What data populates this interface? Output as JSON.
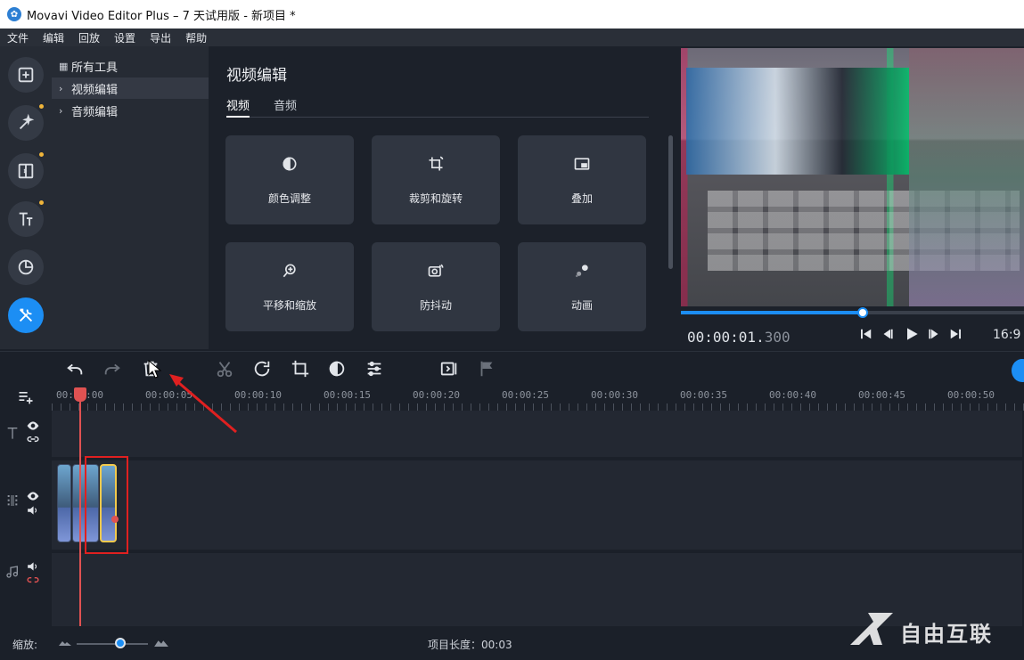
{
  "window": {
    "title": "Movavi Video Editor Plus – 7 天试用版 - 新项目 *"
  },
  "menu": [
    "文件",
    "编辑",
    "回放",
    "设置",
    "导出",
    "帮助"
  ],
  "rail": {
    "icons": [
      "import-icon",
      "magic-wand-icon",
      "transition-icon",
      "titles-icon",
      "sticker-icon",
      "tools-icon"
    ]
  },
  "tree": {
    "items": [
      {
        "label": "所有工具"
      },
      {
        "label": "视频编辑"
      },
      {
        "label": "音频编辑"
      }
    ],
    "selected_index": 1
  },
  "tools": {
    "title": "视频编辑",
    "tabs": [
      {
        "label": "视频"
      },
      {
        "label": "音频"
      }
    ],
    "active_tab": 0,
    "tiles": [
      {
        "label": "颜色调整",
        "icon": "contrast-icon"
      },
      {
        "label": "裁剪和旋转",
        "icon": "crop-rotate-icon"
      },
      {
        "label": "叠加",
        "icon": "overlay-icon"
      },
      {
        "label": "平移和缩放",
        "icon": "zoom-icon"
      },
      {
        "label": "防抖动",
        "icon": "stabilize-icon"
      },
      {
        "label": "动画",
        "icon": "animation-icon"
      }
    ]
  },
  "preview": {
    "timecode_main": "00:00:01.",
    "timecode_ms": "300",
    "aspect": "16:9",
    "progress_fraction": 0.53
  },
  "timeline": {
    "ruler": [
      "00:00:00",
      "00:00:05",
      "00:00:10",
      "00:00:15",
      "00:00:20",
      "00:00:25",
      "00:00:30",
      "00:00:35",
      "00:00:40",
      "00:00:45",
      "00:00:50"
    ]
  },
  "bottom": {
    "zoom_label": "缩放:",
    "project_length": "项目长度：00:03"
  },
  "watermark": {
    "text": "自由互联"
  },
  "colors": {
    "accent": "#1c8ef4",
    "playhead": "#e05252",
    "highlight": "#e02020"
  }
}
